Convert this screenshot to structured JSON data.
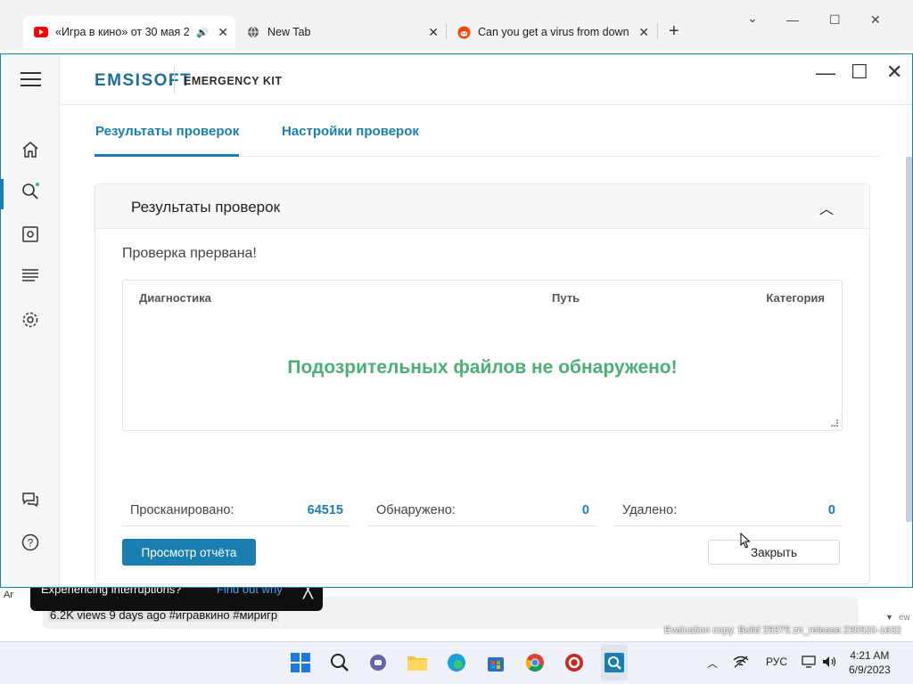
{
  "browser": {
    "tabs": [
      {
        "title": "«Игра в кино» от 30 мая 20",
        "icon": "youtube-icon",
        "active": true
      },
      {
        "title": "New Tab",
        "icon": "globe-icon",
        "active": false
      },
      {
        "title": "Can you get a virus from downlo",
        "icon": "reddit-icon",
        "active": false
      }
    ],
    "background_page": {
      "toast_text": "Experiencing interruptions?",
      "toast_link": "Find out why",
      "video_stats": "6.2K views  9 days ago  #игравкино #миригр",
      "left_clip": "Ar",
      "right_clip": "ew"
    }
  },
  "app": {
    "brand": "EMSISOFT",
    "product": "EMERGENCY KIT",
    "tabs": [
      "Результаты проверок",
      "Настройки проверок"
    ],
    "card_title": "Результаты проверок",
    "status": "Проверка прервана!",
    "columns": [
      "Диагностика",
      "Путь",
      "Категория"
    ],
    "empty_message": "Подозрительных файлов не обнаружено!",
    "stats": {
      "scanned_label": "Просканировано:",
      "scanned_value": "64515",
      "detected_label": "Обнаружено:",
      "detected_value": "0",
      "removed_label": "Удалено:",
      "removed_value": "0"
    },
    "buttons": {
      "view_report": "Просмотр отчёта",
      "close": "Закрыть"
    },
    "sidebar_icons": [
      "home-icon",
      "scan-icon",
      "quarantine-icon",
      "logs-icon",
      "settings-icon",
      "feedback-icon",
      "help-icon"
    ]
  },
  "watermark": "Evaluation copy. Build 25375.zn_release.230520-1632",
  "taskbar": {
    "language": "РУС",
    "time": "4:21 AM",
    "date": "6/9/2023"
  },
  "colors": {
    "accent": "#1a7fb0",
    "success": "#4caf73"
  }
}
